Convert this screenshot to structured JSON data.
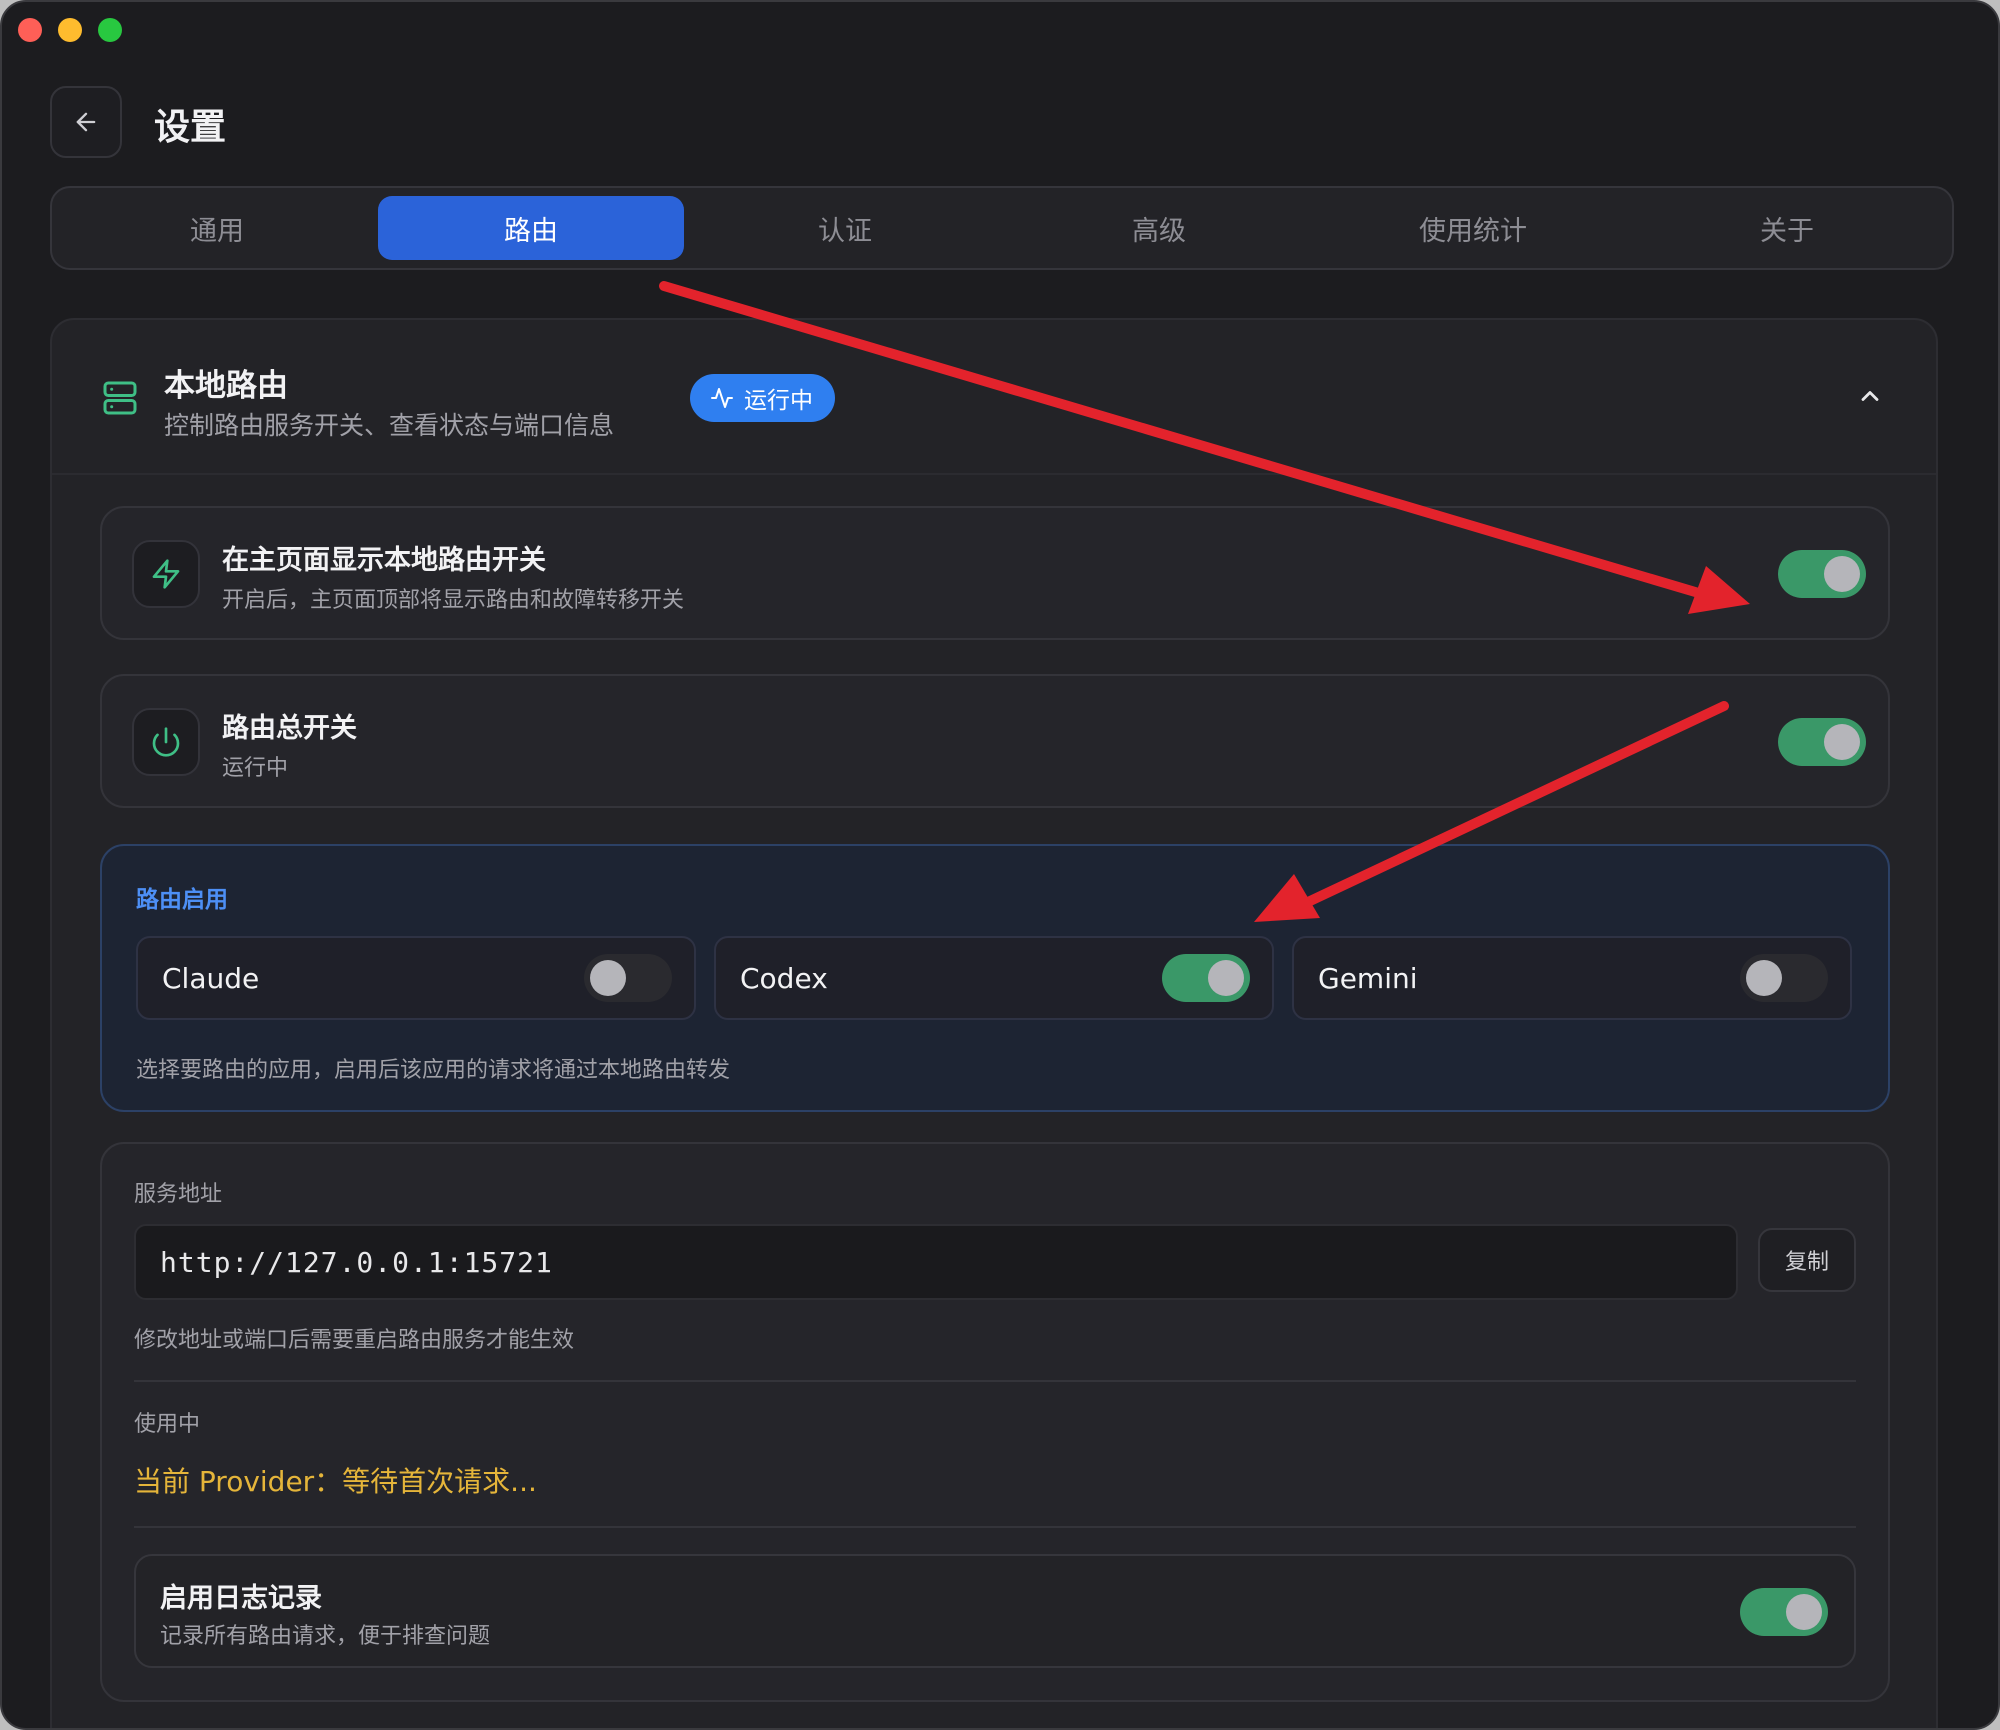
{
  "header": {
    "title": "设置"
  },
  "tabs": [
    {
      "label": "通用",
      "active": false
    },
    {
      "label": "路由",
      "active": true
    },
    {
      "label": "认证",
      "active": false
    },
    {
      "label": "高级",
      "active": false
    },
    {
      "label": "使用统计",
      "active": false
    },
    {
      "label": "关于",
      "active": false
    }
  ],
  "local_routing": {
    "title": "本地路由",
    "subtitle": "控制路由服务开关、查看状态与端口信息",
    "status_badge": "运行中"
  },
  "show_on_home": {
    "title": "在主页面显示本地路由开关",
    "description": "开启后，主页面顶部将显示路由和故障转移开关",
    "enabled": true
  },
  "master_switch": {
    "title": "路由总开关",
    "status": "运行中",
    "enabled": true
  },
  "route_apps": {
    "title": "路由启用",
    "apps": [
      {
        "name": "Claude",
        "enabled": false
      },
      {
        "name": "Codex",
        "enabled": true
      },
      {
        "name": "Gemini",
        "enabled": false
      }
    ],
    "note": "选择要路由的应用，启用后该应用的请求将通过本地路由转发"
  },
  "service": {
    "address_label": "服务地址",
    "address_value": "http://127.0.0.1:15721",
    "copy_label": "复制",
    "note": "修改地址或端口后需要重启路由服务才能生效",
    "in_use_label": "使用中",
    "current_provider": "当前 Provider：等待首次请求..."
  },
  "logging": {
    "title": "启用日志记录",
    "description": "记录所有路由请求，便于排查问题",
    "enabled": true
  },
  "colors": {
    "accent_blue": "#2b63d9",
    "toggle_on": "#3a9868",
    "annotation_red": "#e3232c",
    "provider_yellow": "#e5b53a"
  }
}
